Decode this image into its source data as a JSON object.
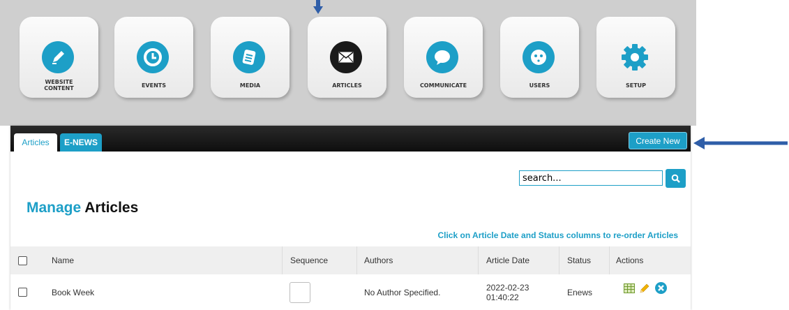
{
  "nav_tiles": [
    {
      "label": "WEBSITE\nCONTENT",
      "icon": "pencil-icon"
    },
    {
      "label": "EVENTS",
      "icon": "clock-icon"
    },
    {
      "label": "MEDIA",
      "icon": "document-icon"
    },
    {
      "label": "ARTICLES",
      "icon": "envelope-icon"
    },
    {
      "label": "COMMUNICATE",
      "icon": "speech-bubble-icon"
    },
    {
      "label": "USERS",
      "icon": "smiley-face-icon"
    },
    {
      "label": "SETUP",
      "icon": "gear-icon"
    }
  ],
  "tabs": {
    "articles": "Articles",
    "enews": "E-NEWS"
  },
  "toolbar": {
    "create_new": "Create New"
  },
  "search": {
    "value": "search..."
  },
  "page": {
    "title_part1": "Manage",
    "title_part2": "Articles"
  },
  "hint": "Click on Article Date and Status columns to re-order Articles",
  "table": {
    "headers": {
      "name": "Name",
      "sequence": "Sequence",
      "authors": "Authors",
      "article_date": "Article Date",
      "status": "Status",
      "actions": "Actions"
    },
    "rows": [
      {
        "name": "Book Week",
        "authors": "No Author Specified.",
        "date": "2022-02-23",
        "time": "01:40:22",
        "status": "Enews"
      }
    ]
  },
  "colors": {
    "accent": "#1d9fc7",
    "arrow": "#2f5ea8",
    "header_bar": "#111111"
  }
}
